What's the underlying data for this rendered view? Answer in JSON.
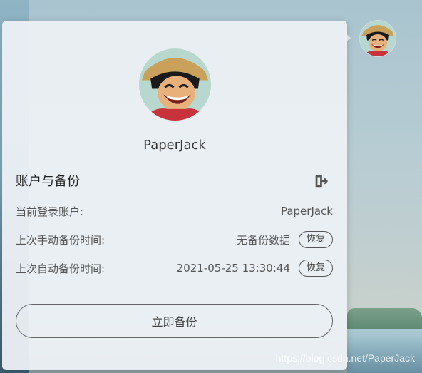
{
  "profile": {
    "username": "PaperJack"
  },
  "account": {
    "section_title": "账户与备份",
    "logout_icon": "logout-icon",
    "rows": [
      {
        "label": "当前登录账户:",
        "value": "PaperJack"
      },
      {
        "label": "上次手动备份时间:",
        "value": "无备份数据",
        "button": "恢复"
      },
      {
        "label": "上次自动备份时间:",
        "value": "2021-05-25 13:30:44",
        "button": "恢复"
      }
    ],
    "backup_button": "立即备份"
  },
  "watermark": "https://blog.csdn.net/PaperJack",
  "colors": {
    "panel_bg": "#ECF0F4",
    "text_primary": "#333333",
    "text_secondary": "#555555"
  }
}
